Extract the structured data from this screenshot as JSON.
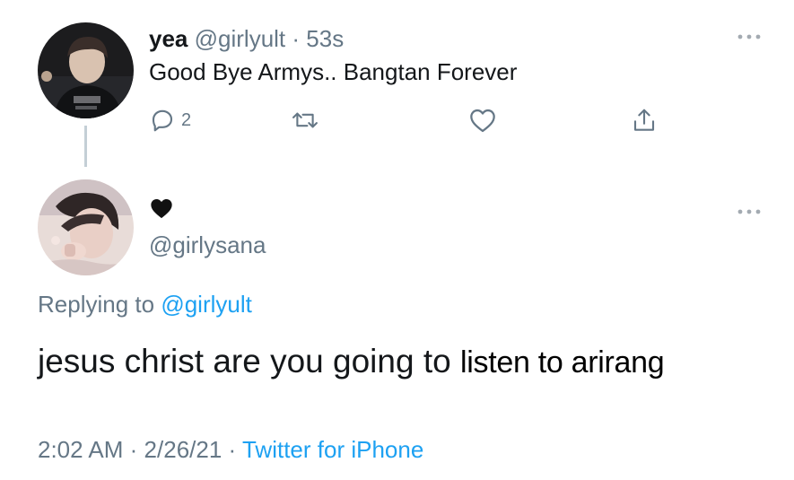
{
  "tweet_1": {
    "avatar_icon": "user-avatar-photo",
    "display_name": "yea",
    "handle": "@girlyult",
    "separator": "·",
    "time_ago": "53s",
    "text": "Good Bye Armys.. Bangtan Forever",
    "actions": {
      "reply_icon": "reply-icon",
      "reply_count": "2",
      "retweet_icon": "retweet-icon",
      "like_icon": "heart-icon",
      "share_icon": "share-icon"
    },
    "more_icon": "more-dots-icon"
  },
  "tweet_2": {
    "avatar_icon": "user-avatar-photo",
    "display_name_icon": "black-heart-icon",
    "handle": "@girlysana",
    "replying_prefix": "Replying to",
    "replying_to": "@girlyult",
    "text": "jesus christ are you going to",
    "text_overlay": "listen to arirang",
    "timestamp": "2:02 AM",
    "separator": "·",
    "date": "2/26/21",
    "separator_2": "·",
    "source": "Twitter for iPhone",
    "more_icon": "more-dots-icon"
  },
  "colors": {
    "text_primary": "#14171a",
    "text_secondary": "#657786",
    "link": "#1da1f2",
    "thread_line": "#c4cfd6",
    "background": "#ffffff"
  }
}
